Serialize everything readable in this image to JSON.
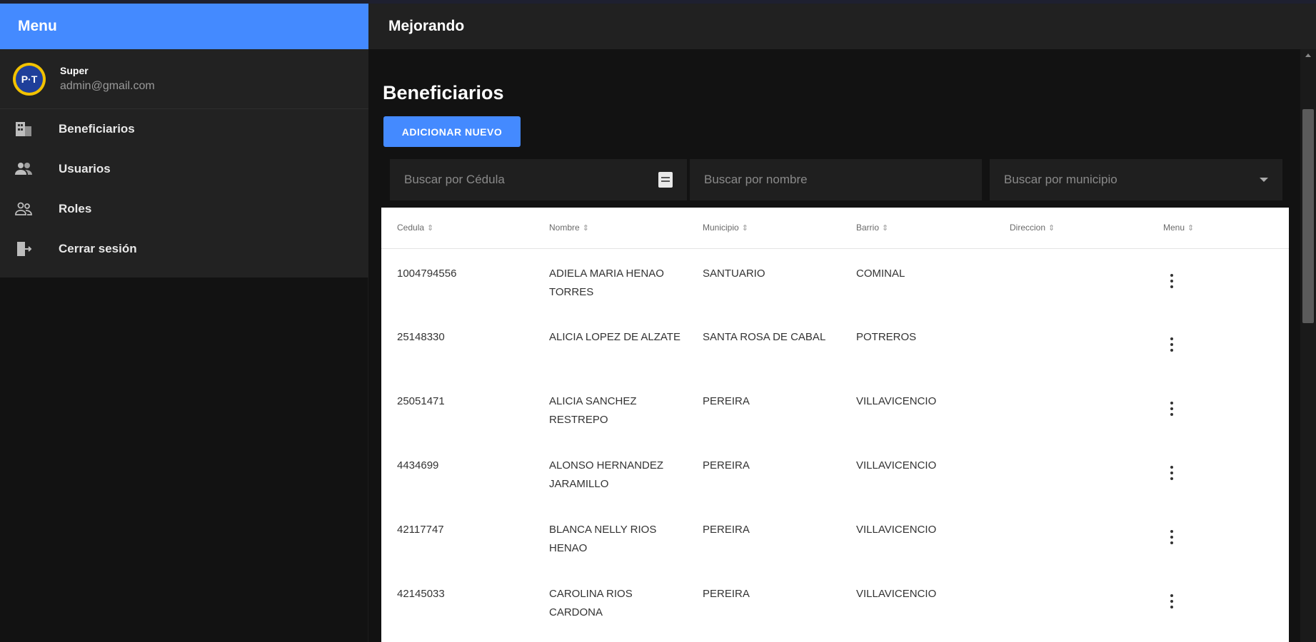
{
  "sidebar": {
    "title": "Menu",
    "user": {
      "avatar_text": "P·T",
      "name": "Super",
      "email": "admin@gmail.com"
    },
    "items": [
      {
        "label": "Beneficiarios",
        "icon": "building-icon"
      },
      {
        "label": "Usuarios",
        "icon": "group-icon"
      },
      {
        "label": "Roles",
        "icon": "people-outline-icon"
      },
      {
        "label": "Cerrar sesión",
        "icon": "logout-icon"
      }
    ]
  },
  "topbar": {
    "title": "Mejorando"
  },
  "main": {
    "page_title": "Beneficiarios",
    "add_button": "ADICIONAR NUEVO",
    "filters": {
      "cedula_placeholder": "Buscar por Cédula",
      "nombre_placeholder": "Buscar por nombre",
      "municipio_placeholder": "Buscar por municipio"
    },
    "table": {
      "columns": [
        "Cedula",
        "Nombre",
        "Municipio",
        "Barrio",
        "Direccion",
        "Menu"
      ],
      "rows": [
        {
          "cedula": "1004794556",
          "nombre": "ADIELA MARIA HENAO TORRES",
          "municipio": "SANTUARIO",
          "barrio": "COMINAL",
          "direccion": ""
        },
        {
          "cedula": "25148330",
          "nombre": "ALICIA LOPEZ DE ALZATE",
          "municipio": "SANTA ROSA DE CABAL",
          "barrio": "POTREROS",
          "direccion": ""
        },
        {
          "cedula": "25051471",
          "nombre": "ALICIA SANCHEZ RESTREPO",
          "municipio": "PEREIRA",
          "barrio": "VILLAVICENCIO",
          "direccion": ""
        },
        {
          "cedula": "4434699",
          "nombre": "ALONSO HERNANDEZ JARAMILLO",
          "municipio": "PEREIRA",
          "barrio": "VILLAVICENCIO",
          "direccion": ""
        },
        {
          "cedula": "42117747",
          "nombre": "BLANCA NELLY RIOS HENAO",
          "municipio": "PEREIRA",
          "barrio": "VILLAVICENCIO",
          "direccion": ""
        },
        {
          "cedula": "42145033",
          "nombre": "CAROLINA RIOS CARDONA",
          "municipio": "PEREIRA",
          "barrio": "VILLAVICENCIO",
          "direccion": ""
        }
      ]
    }
  },
  "colors": {
    "primary": "#448aff",
    "background": "#121212",
    "surface": "#222222"
  }
}
